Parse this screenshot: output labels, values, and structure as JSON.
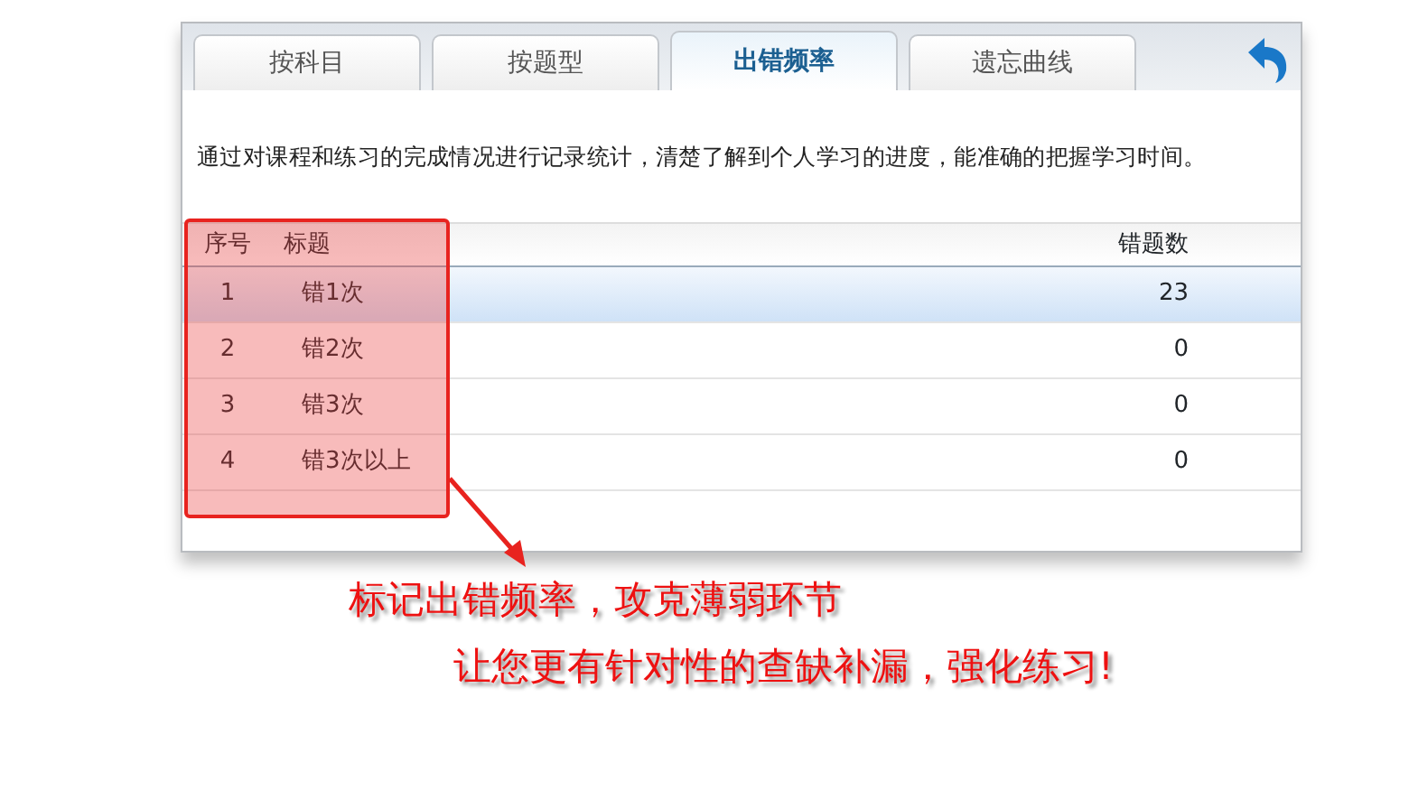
{
  "tabs": [
    {
      "label": "按科目",
      "selected": false
    },
    {
      "label": "按题型",
      "selected": false
    },
    {
      "label": "出错频率",
      "selected": true
    },
    {
      "label": "遗忘曲线",
      "selected": false
    }
  ],
  "description": "通过对课程和练习的完成情况进行记录统计，清楚了解到个人学习的进度，能准确的把握学习时间。",
  "table": {
    "columns": [
      "序号",
      "标题",
      "错题数"
    ],
    "rows": [
      {
        "cells": [
          "1",
          "错1次",
          "23"
        ],
        "selected": true
      },
      {
        "cells": [
          "2",
          "错2次",
          "0"
        ],
        "selected": false
      },
      {
        "cells": [
          "3",
          "错3次",
          "0"
        ],
        "selected": false
      },
      {
        "cells": [
          "4",
          "错3次以上",
          "0"
        ],
        "selected": false
      }
    ]
  },
  "callout": [
    "标记出错频率，攻克薄弱环节",
    "让您更有针对性的查缺补漏，强化练习!"
  ]
}
